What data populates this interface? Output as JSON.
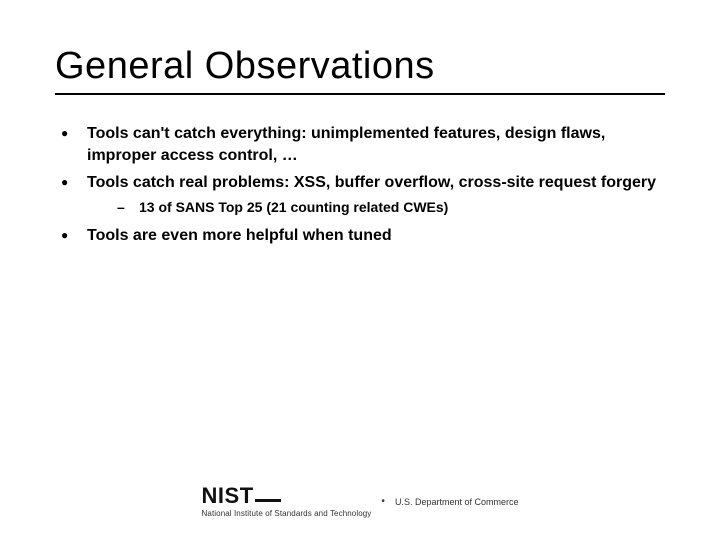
{
  "title": "General Observations",
  "bullets": [
    {
      "text": "Tools can't catch everything: unimplemented features, design flaws, improper access control, …"
    },
    {
      "text": "Tools catch real problems: XSS, buffer overflow, cross-site request forgery",
      "sub": [
        "13 of SANS Top 25 (21 counting related CWEs)"
      ]
    },
    {
      "text": "Tools are even more helpful when tuned"
    }
  ],
  "footer": {
    "logo_text": "NIST",
    "logo_sub": "National Institute of Standards and Technology",
    "separator": "•",
    "dept": "U.S. Department of Commerce"
  }
}
